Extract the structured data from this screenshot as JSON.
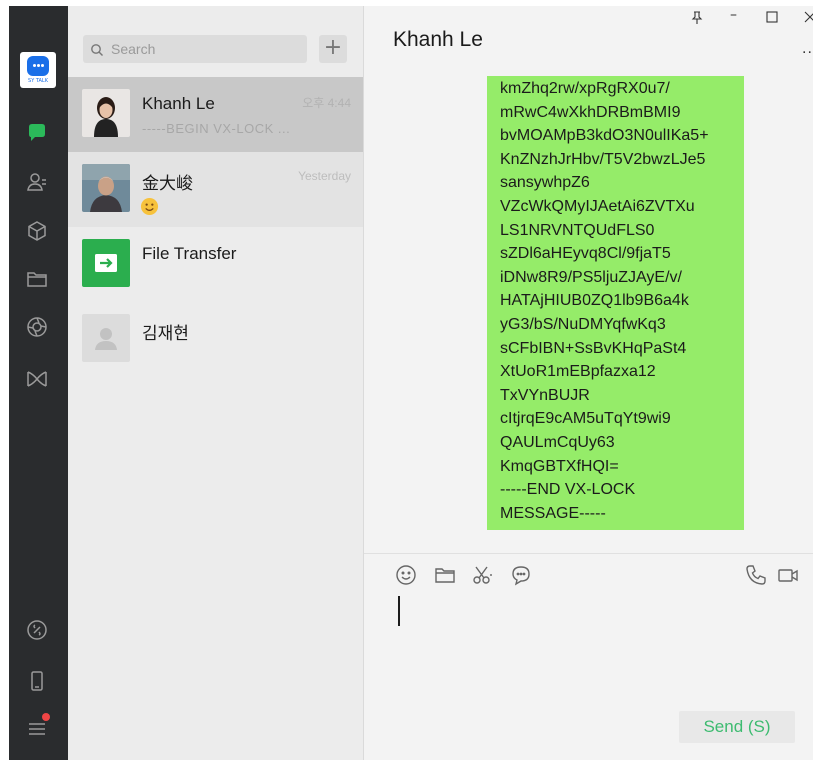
{
  "brand": {
    "logo_caption": "SY TALK",
    "accent": "#2bba5a"
  },
  "search": {
    "placeholder": "Search",
    "add_label": "+"
  },
  "chats": [
    {
      "name": "Khanh Le",
      "preview": "-----BEGIN VX-LOCK ...",
      "time": "오후 4:44"
    },
    {
      "name": "金大峻",
      "preview": "",
      "time": "Yesterday"
    },
    {
      "name": "File Transfer",
      "preview": "",
      "time": ""
    },
    {
      "name": "김재현",
      "preview": "",
      "time": ""
    }
  ],
  "conversation": {
    "title": "Khanh Le",
    "more": "..",
    "message_lines": [
      "kmZhq2rw/xpRgRX0u7/",
      "mRwC4wXkhDRBmBMI9",
      "bvMOAMpB3kdO3N0ulIKa5+",
      "KnZNzhJrHbv/T5V2bwzLJe5",
      "sansywhpZ6",
      "VZcWkQMyIJAetAi6ZVTXu",
      "LS1NRVNTQUdFLS0",
      "sZDl6aHEyvq8Cl/9fjaT5",
      "iDNw8R9/PS5ljuZJAyE/v/",
      "HATAjHIUB0ZQ1lb9B6a4k",
      "yG3/bS/NuDMYqfwKq3",
      "sCFbIBN+SsBvKHqPaSt4",
      "XtUoR1mEBpfazxa12",
      "TxVYnBUJR",
      "cItjrqE9cAM5uTqYt9wi9",
      "QAULmCqUy63",
      "KmqGBTXfHQI=",
      "-----END VX-LOCK",
      "MESSAGE-----"
    ]
  },
  "composer": {
    "send_label": "Send (S)"
  }
}
